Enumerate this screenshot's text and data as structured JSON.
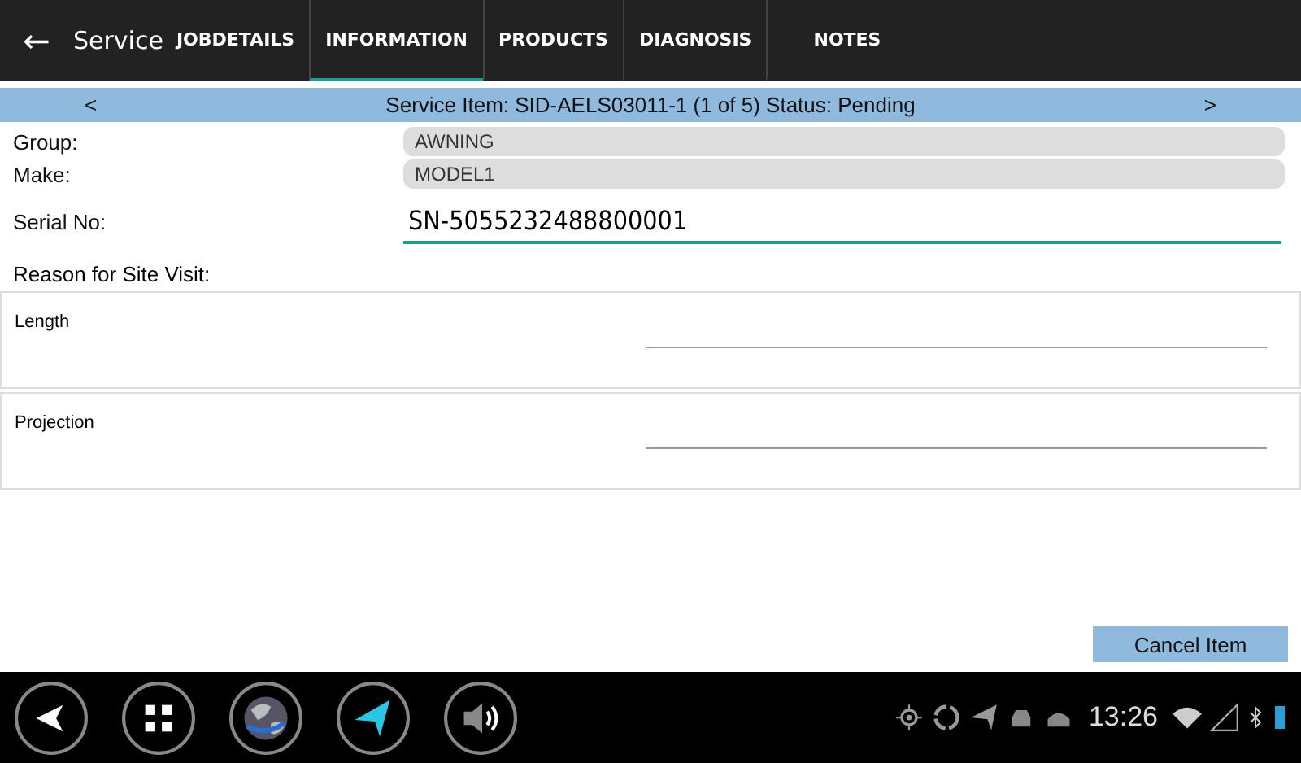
{
  "app_bar": {
    "back": "←",
    "title": "Service"
  },
  "tabs": [
    {
      "label": "JOBDETAILS",
      "selected": false
    },
    {
      "label": "INFORMATION",
      "selected": true
    },
    {
      "label": "PRODUCTS",
      "selected": false
    },
    {
      "label": "DIAGNOSIS",
      "selected": false
    },
    {
      "label": "NOTES",
      "selected": false
    }
  ],
  "item_nav": {
    "prev": "<",
    "title": "Service Item: SID-AELS03011-1 (1 of 5) Status: Pending",
    "next": ">"
  },
  "fields": [
    {
      "label": "Group:",
      "value": "AWNING",
      "kind": "readonly"
    },
    {
      "label": "Make:",
      "value": "MODEL1",
      "kind": "readonly"
    },
    {
      "label": "Serial No:",
      "value": "SN-5055232488800001",
      "kind": "input"
    }
  ],
  "section_label": "Reason for Site Visit:",
  "measurements": [
    {
      "label": "Length"
    },
    {
      "label": "Projection"
    }
  ],
  "cancel_button": "Cancel Item",
  "status_bar": {
    "time": "13:26"
  }
}
